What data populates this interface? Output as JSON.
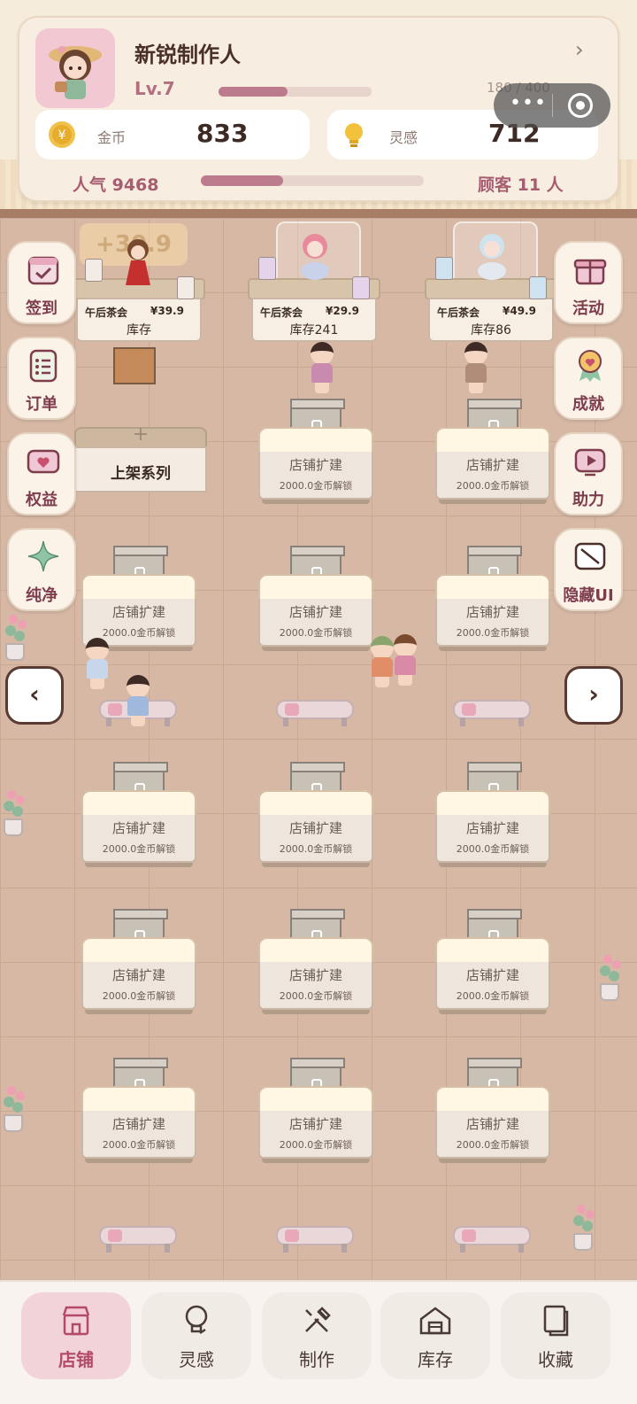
{
  "header": {
    "name": "新锐制作人",
    "level": "Lv.7",
    "xp_text": "180 / 400",
    "xp_progress": 0.45,
    "gold_label": "金币",
    "gold_value": "833",
    "inspiration_label": "灵感",
    "inspiration_value": "712",
    "popularity": "人气 9468",
    "popularity_progress": 0.37,
    "customers": "顾客 11 人"
  },
  "side_left": [
    {
      "label": "签到",
      "icon": "calendar-check-icon"
    },
    {
      "label": "订单",
      "icon": "order-list-icon"
    },
    {
      "label": "权益",
      "icon": "ticket-heart-icon"
    },
    {
      "label": "纯净",
      "icon": "sparkle-icon"
    }
  ],
  "side_right": [
    {
      "label": "活动",
      "icon": "gift-icon"
    },
    {
      "label": "成就",
      "icon": "medal-icon"
    },
    {
      "label": "助力",
      "icon": "video-icon"
    },
    {
      "label": "隐藏UI",
      "icon": "hide-icon"
    }
  ],
  "nav": {
    "prev": "‹",
    "next": "›"
  },
  "float_text": "+30.9",
  "shelves": [
    {
      "name": "午后茶会",
      "price": "¥39.9",
      "stock": "库存"
    },
    {
      "name": "午后茶会",
      "price": "¥29.9",
      "stock": "库存241"
    },
    {
      "name": "午后茶会",
      "price": "¥49.9",
      "stock": "库存86"
    }
  ],
  "add_series": "上架系列",
  "locked_counter": {
    "title": "店铺扩建",
    "cost": "2000.0金币解锁"
  },
  "tabs": [
    {
      "label": "店铺",
      "icon": "shop-icon",
      "active": true
    },
    {
      "label": "灵感",
      "icon": "lightbulb-icon",
      "active": false
    },
    {
      "label": "制作",
      "icon": "tools-icon",
      "active": false
    },
    {
      "label": "库存",
      "icon": "warehouse-icon",
      "active": false
    },
    {
      "label": "收藏",
      "icon": "collection-icon",
      "active": false
    }
  ],
  "colors": {
    "accent": "#b24a68",
    "progress": "#bd7c8d",
    "floor": "#d7b8a5"
  }
}
